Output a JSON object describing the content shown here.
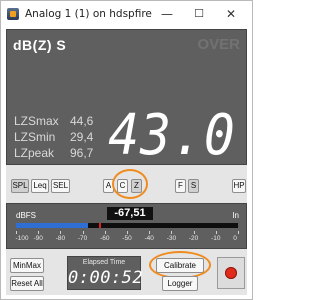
{
  "window": {
    "title": "Analog 1 (1) on hdspfire",
    "minimize_glyph": "—",
    "maximize_glyph": "☐",
    "close_glyph": "✕"
  },
  "display": {
    "mode": "dB(Z) S",
    "over": "OVER",
    "value": "43.0",
    "stats": [
      {
        "name": "LZSmax",
        "value": "44,6"
      },
      {
        "name": "LZSmin",
        "value": "29,4"
      },
      {
        "name": "LZpeak",
        "value": "96,7"
      }
    ]
  },
  "buttons": {
    "spl": "SPL",
    "leq": "Leq",
    "sel": "SEL",
    "weighting": [
      "A",
      "C",
      "Z"
    ],
    "weighting_selected": "Z",
    "time": [
      "F",
      "S"
    ],
    "time_selected": "S",
    "hp": "HP"
  },
  "meter": {
    "unit": "dBFS",
    "channel": "In",
    "readout": "-67,51",
    "level_dbfs": -67.51,
    "peak_dbfs": -62,
    "scale": [
      "-100",
      "-90",
      "-80",
      "-70",
      "-60",
      "-50",
      "-40",
      "-30",
      "-20",
      "-10",
      "0"
    ],
    "colors": {
      "bar": "#2f6fd3",
      "peak": "#e02020"
    }
  },
  "bottom": {
    "minmax": "MinMax",
    "reset_all": "Reset All",
    "elapsed_title": "Elapsed Time",
    "elapsed_time": "0:00:52",
    "calibrate": "Calibrate",
    "logger": "Logger"
  },
  "highlight_color": "#ef8b1f"
}
